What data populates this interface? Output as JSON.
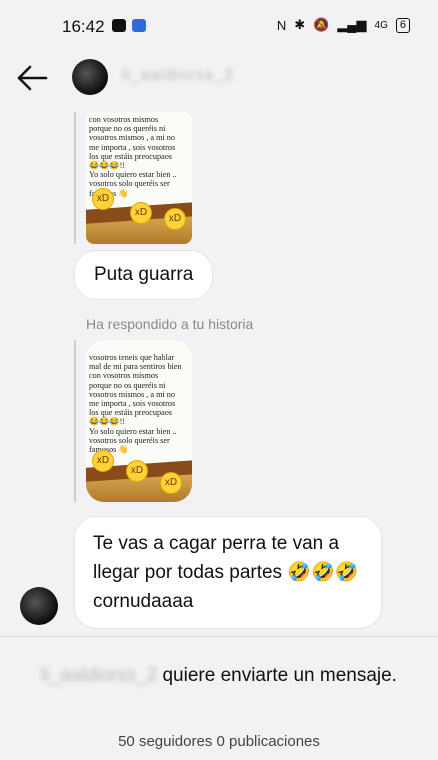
{
  "status_bar": {
    "time": "16:42",
    "signal_label": "4G",
    "battery": "6"
  },
  "header": {
    "username": "li_aaldiorss_2"
  },
  "stories": [
    {
      "text": "con vosotros mismos\nporque no os queréis ni\nvosotros mismos , a mi no\nme importa , sois vosotros\nlos que estáis preocupaos\n😂😂😂!!\nYo solo quiero estar bien ..\nvosotros solo queréis ser\nfamosos 👋"
    },
    {
      "text": "vosotros teneis que hablar\nmal de mi para sentiros bien\ncon vosotros mismos\nporque no os queréis ni\nvosotros mismos , a mi no\nme importa , sois vosotros\nlos que estáis preocupaos\n😂😂😂!!\nYo solo quiero estar bien ..\nvosotros solo queréis ser\nfamosos 👋"
    }
  ],
  "messages": [
    {
      "text": "Puta guarra"
    },
    {
      "text": "Te vas a cagar perra te van a llegar por todas partes 🤣🤣🤣cornudaaaa"
    }
  ],
  "replied_label": "Ha respondido a tu historia",
  "request": {
    "username_blurred": "li_aaldiorss_2",
    "text": "quiere enviarte un mensaje."
  },
  "profile_counts": "50 seguidores 0 publicaciones",
  "colors": {
    "background": "#f2f2f4",
    "bubble": "#ffffff",
    "muted": "#8a8a8e"
  }
}
